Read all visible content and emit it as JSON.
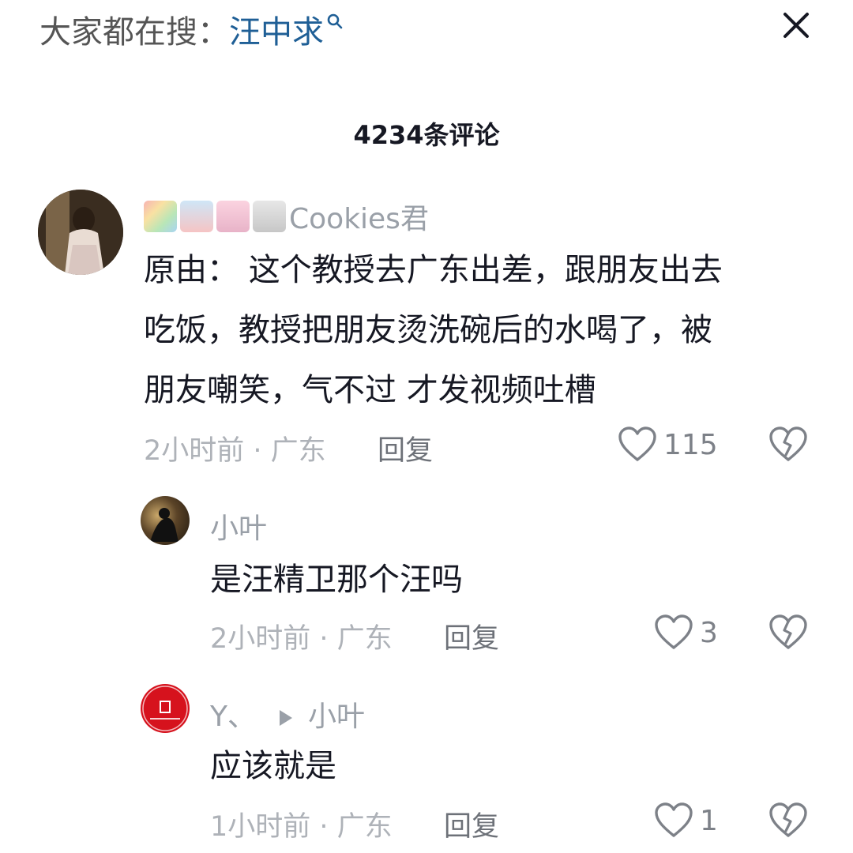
{
  "search": {
    "prefix": "大家都在搜：",
    "keyword": "汪中求"
  },
  "comment_count": "4234条评论",
  "comments": [
    {
      "user": "Cookies君",
      "text_lines": [
        "原由： 这个教授去广东出差，跟朋友出去",
        "吃饭，教授把朋友烫洗碗后的水喝了，被",
        "朋友嘲笑，气不过 才发视频吐槽"
      ],
      "time_location": "2小时前 · 广东",
      "reply_label": "回复",
      "likes": "115"
    }
  ],
  "replies": [
    {
      "user": "小叶",
      "text": "是汪精卫那个汪吗",
      "time_location": "2小时前 · 广东",
      "reply_label": "回复",
      "likes": "3"
    },
    {
      "user": "Y、",
      "reply_to": "小叶",
      "text": "应该就是",
      "time_location": "1小时前 · 广东",
      "reply_label": "回复",
      "likes": "1"
    }
  ],
  "colors": {
    "keyword": "#1f5f96",
    "secondary": "#aeb2b8",
    "primary_text": "#161823"
  }
}
